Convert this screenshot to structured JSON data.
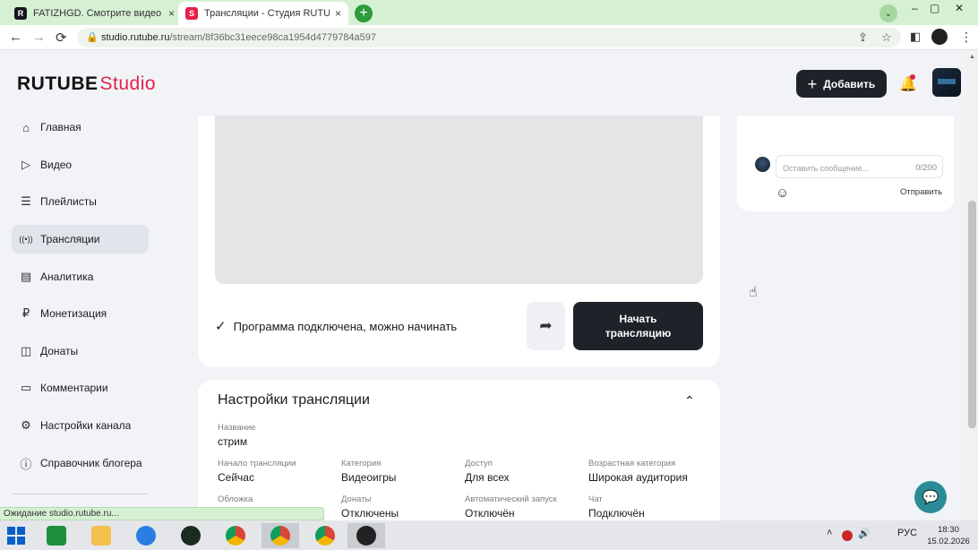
{
  "browser": {
    "tabs": [
      {
        "title": "FATIZHGD. Смотрите видео онлайн",
        "close": "×",
        "fav_letter": "R",
        "fav_color": "#16161d"
      },
      {
        "title": "Трансляции - Студия RUTUBE",
        "close": "×",
        "fav_letter": "S",
        "fav_color": "#e4204a"
      }
    ],
    "new_tab": "+",
    "tab_search": "⌄",
    "win_min": "–",
    "win_max": "▢",
    "win_close": "✕",
    "back": "←",
    "forward": "→",
    "reload": "⟳",
    "url_host": "studio.rutube.ru",
    "url_path": "/stream/8f36bc31eece98ca1954d4779784a597",
    "lock": "🔒",
    "share_page": "⇪",
    "bookmark": "☆",
    "sidepanel": "◧",
    "menu": "⋮",
    "status_text": "Ожидание studio.rutube.ru..."
  },
  "header": {
    "logo_main": "RUTUBE",
    "logo_studio": "Studio",
    "add_plus": "+",
    "add_label": "Добавить",
    "bell": "🔔"
  },
  "sidebar": {
    "items": [
      {
        "label": "Главная",
        "icon": "⌂"
      },
      {
        "label": "Видео",
        "icon": "▷"
      },
      {
        "label": "Плейлисты",
        "icon": "☰"
      },
      {
        "label": "Трансляции",
        "icon": "((•))"
      },
      {
        "label": "Аналитика",
        "icon": "▤"
      },
      {
        "label": "Монетизация",
        "icon": "₽"
      },
      {
        "label": "Донаты",
        "icon": "◫"
      },
      {
        "label": "Комментарии",
        "icon": "▭"
      },
      {
        "label": "Настройки канала",
        "icon": "⚙"
      },
      {
        "label": "Справочник блогера",
        "icon": "ⓘ"
      }
    ]
  },
  "stream": {
    "check": "✓",
    "status": "Программа подключена, можно начинать",
    "share": "➦",
    "start_label": "Начать трансляцию"
  },
  "settings": {
    "title": "Настройки трансляции",
    "collapse": "⌃",
    "name_label": "Название",
    "name_value": "стрим",
    "fields": [
      {
        "label": "Начало трансляции",
        "value": "Сейчас"
      },
      {
        "label": "Категория",
        "value": "Видеоигры"
      },
      {
        "label": "Доступ",
        "value": "Для всех"
      },
      {
        "label": "Возрастная категория",
        "value": "Широкая аудитория"
      },
      {
        "label": "Обложка",
        "value": ""
      },
      {
        "label": "Донаты",
        "value": "Отключены"
      },
      {
        "label": "Автоматический запуск",
        "value": "Отключён"
      },
      {
        "label": "Чат",
        "value": "Подключён"
      }
    ]
  },
  "chat": {
    "placeholder": "Оставить сообщение...",
    "counter": "0/200",
    "emoji": "☺",
    "send": "Отправить"
  },
  "help": "💬",
  "cursor": "☝",
  "taskbar": {
    "tray_arrow": "˄",
    "volume": "🔊",
    "lang": "РУС",
    "time": "18:30",
    "date": "15.02.2026"
  }
}
